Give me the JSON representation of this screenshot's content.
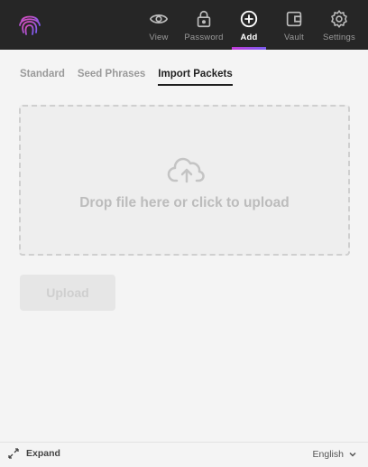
{
  "nav": {
    "items": [
      {
        "label": "View",
        "icon": "eye-icon"
      },
      {
        "label": "Password",
        "icon": "lock-icon"
      },
      {
        "label": "Add",
        "icon": "plus-circle-icon",
        "active": true
      },
      {
        "label": "Vault",
        "icon": "wallet-icon"
      },
      {
        "label": "Settings",
        "icon": "gear-icon"
      }
    ]
  },
  "tabs": [
    {
      "label": "Standard"
    },
    {
      "label": "Seed Phrases"
    },
    {
      "label": "Import Packets",
      "active": true
    }
  ],
  "dropzone": {
    "text": "Drop file here or click to upload",
    "icon": "cloud-upload-icon"
  },
  "upload": {
    "label": "Upload"
  },
  "footer": {
    "expand_label": "Expand",
    "language": "English"
  },
  "colors": {
    "accent_start": "#c13ad8",
    "accent_end": "#7a5cf0",
    "topbar": "#262626"
  }
}
